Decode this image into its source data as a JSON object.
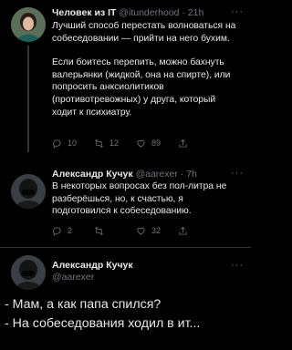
{
  "tweets": [
    {
      "author_name": "Человек из IT",
      "handle": "@itunderhood",
      "separator": " · ",
      "time": "21h",
      "paragraphs": [
        "Лучший способ перестать волноваться на собеседовании — прийти на него бухим.",
        "Если боитесь перепить, можно бахнуть валерьянки (жидкой, она на спирте), или попросить анксиолитиков (противотревожных) у друга, который ходит к психиатру."
      ],
      "replies": "10",
      "retweets": "12",
      "likes": "89"
    },
    {
      "author_name": "Александр Кучук",
      "handle": "@aarexer",
      "separator": " · ",
      "time": "7h",
      "paragraphs": [
        "В некоторых вопросах без пол-литра не разберёшься, но, к счастью, я подготовился к собеседованию."
      ],
      "replies": "2",
      "retweets": "",
      "likes": "32"
    }
  ],
  "main_tweet": {
    "author_name": "Александр Кучук",
    "handle": "@aarexer",
    "lines": [
      "- Мам, а как папа спился?",
      "- На собеседования ходил в ит..."
    ]
  },
  "menu_glyph": "···",
  "colors": {
    "background": "#000000",
    "text": "#e7e9ea",
    "secondary": "#71767b",
    "divider": "#2f3336"
  }
}
